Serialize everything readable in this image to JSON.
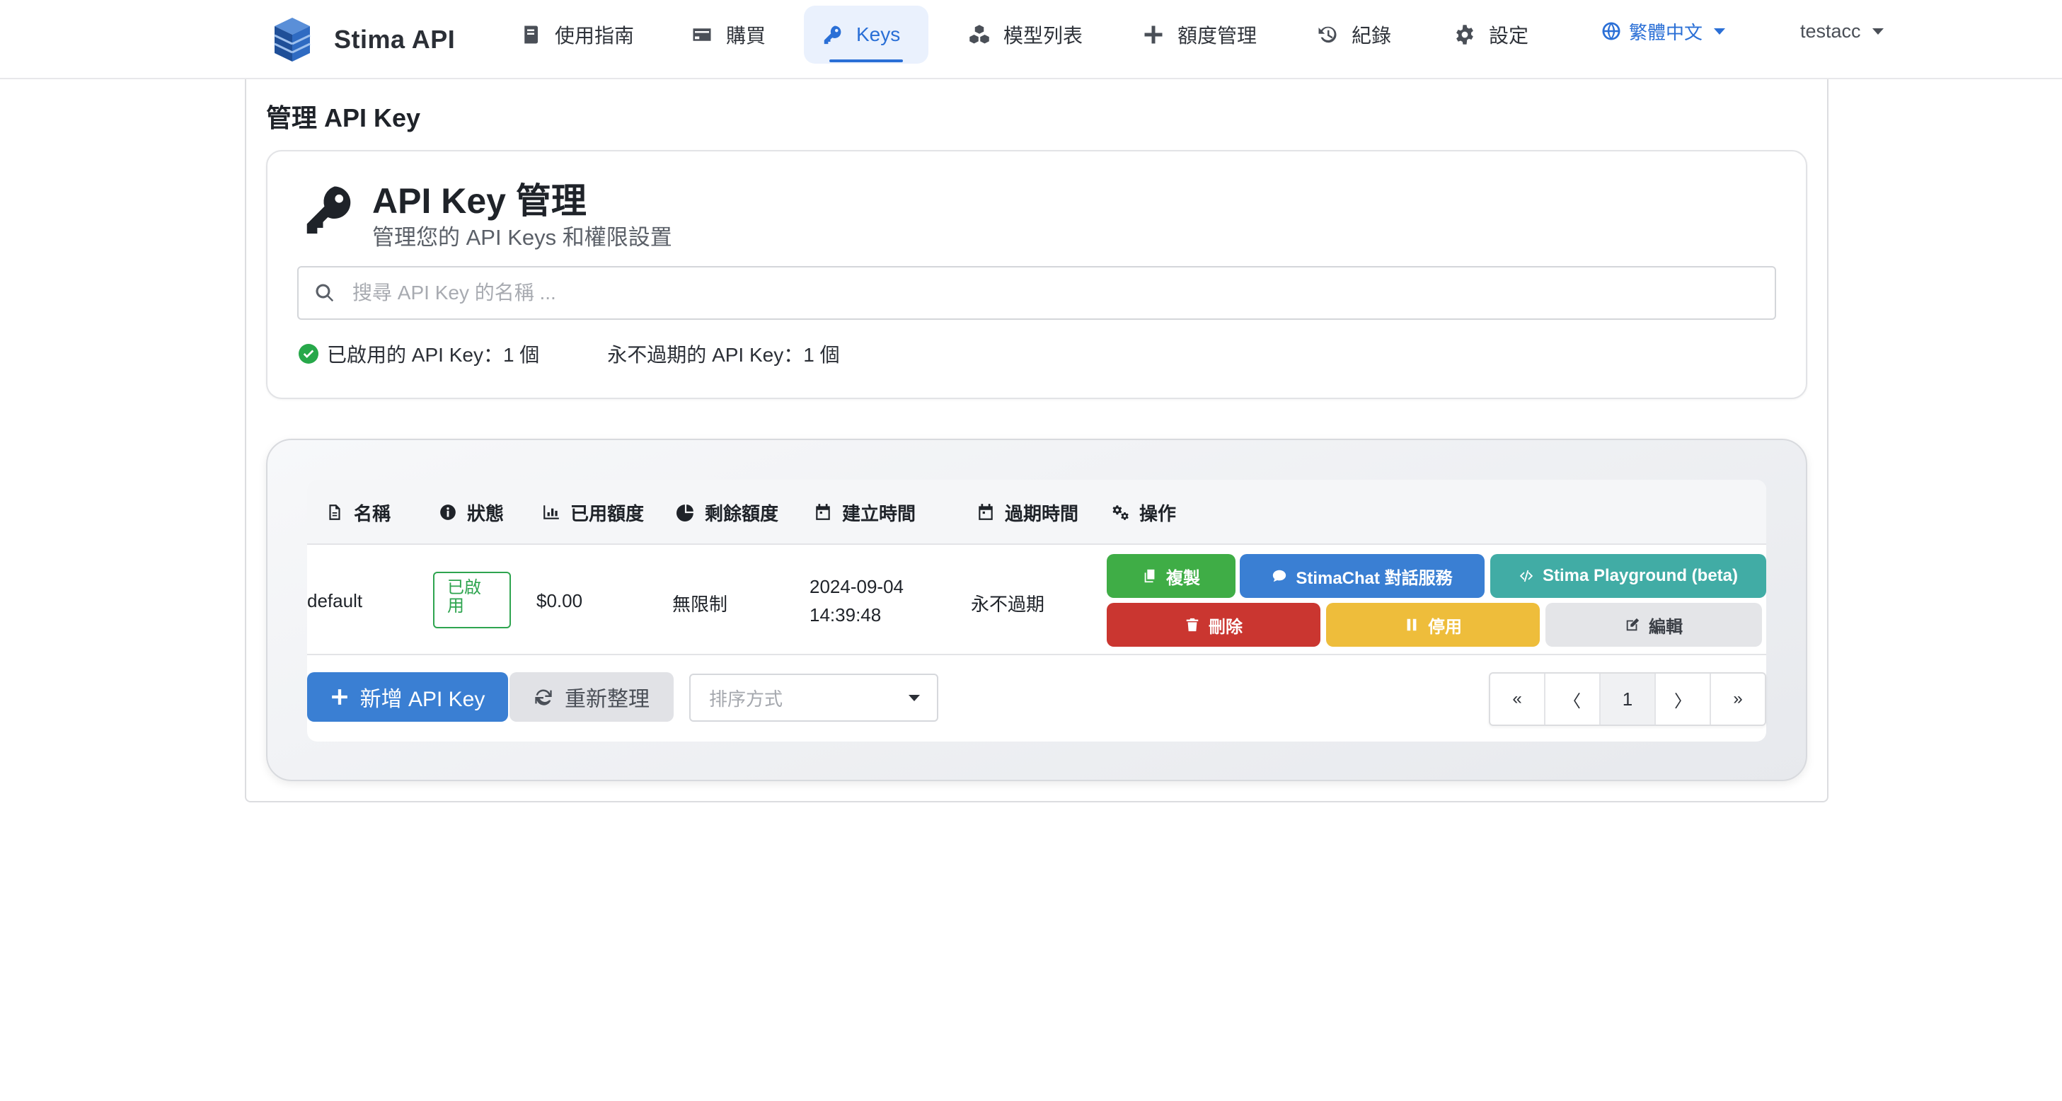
{
  "nav": {
    "brand": "Stima API",
    "items": [
      {
        "label": "使用指南",
        "icon": "book-icon"
      },
      {
        "label": "購買",
        "icon": "credit-card-icon"
      },
      {
        "label": "Keys",
        "icon": "key-icon",
        "active": true
      },
      {
        "label": "模型列表",
        "icon": "cubes-icon"
      },
      {
        "label": "額度管理",
        "icon": "plus-icon"
      },
      {
        "label": "紀錄",
        "icon": "history-icon"
      },
      {
        "label": "設定",
        "icon": "gear-icon"
      }
    ],
    "language": "繁體中文",
    "user": "testacc"
  },
  "page": {
    "title": "管理 API Key",
    "header_title": "API Key 管理",
    "header_subtitle": "管理您的 API Keys 和權限設置",
    "search_placeholder": "搜尋 API Key 的名稱 ...",
    "stats": {
      "enabled": "已啟用的 API Key：1 個",
      "never_expire": "永不過期的 API Key：1 個"
    }
  },
  "table": {
    "columns": [
      "名稱",
      "狀態",
      "已用額度",
      "剩餘額度",
      "建立時間",
      "過期時間",
      "操作"
    ],
    "rows": [
      {
        "name": "default",
        "status": "已啟用",
        "used": "$0.00",
        "remaining": "無限制",
        "created_date": "2024-09-04",
        "created_time": "14:39:48",
        "expires": "永不過期"
      }
    ],
    "actions": {
      "copy": "複製",
      "chat": "StimaChat 對話服務",
      "playground": "Stima Playground (beta)",
      "delete": "刪除",
      "disable": "停用",
      "edit": "編輯"
    }
  },
  "footer": {
    "add_button": "新增 API Key",
    "refresh_button": "重新整理",
    "sort_placeholder": "排序方式",
    "pager": {
      "first": "«",
      "prev": "〈",
      "current": "1",
      "next": "〉",
      "last": "»"
    }
  },
  "colors": {
    "primary": "#2a6fd6",
    "green": "#3fad46",
    "blue": "#3a7fd3",
    "teal": "#41aca5",
    "red": "#ca3630",
    "yellow": "#eebd3b"
  }
}
